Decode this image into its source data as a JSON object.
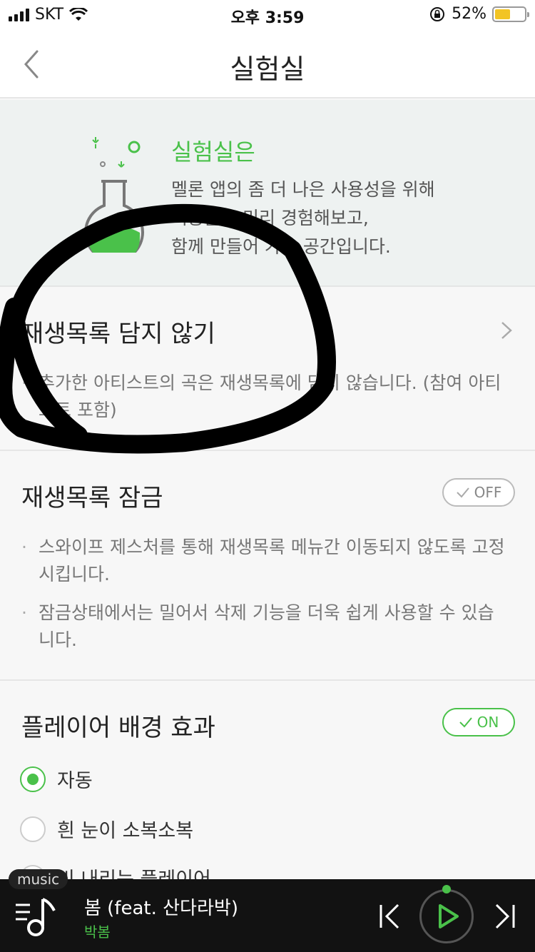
{
  "status_bar": {
    "carrier": "SKT",
    "time": "오후 3:59",
    "battery_percent": "52%",
    "battery_level": 0.52
  },
  "nav": {
    "title": "실험실"
  },
  "intro": {
    "title": "실험실은",
    "line1": "멜론 앱의 좀 더 나은 사용성을 위해",
    "line2": "기능들을 미리 경험해보고,",
    "line3": "함께 만들어 가는 공간입니다."
  },
  "sections": [
    {
      "title": "재생목록 담지 않기",
      "bullets": [
        "추가한 아티스트의 곡은 재생목록에 담지 않습니다. (참여 아티스트 포함)"
      ]
    },
    {
      "title": "재생목록 잠금",
      "toggle": "OFF",
      "bullets": [
        "스와이프 제스처를 통해 재생목록 메뉴간 이동되지 않도록 고정시킵니다.",
        "잠금상태에서는 밀어서 삭제 기능을 더욱 쉽게 사용할 수 있습니다."
      ]
    },
    {
      "title": "플레이어 배경 효과",
      "toggle": "ON",
      "options": [
        "자동",
        "흰 눈이 소복소복",
        "비 내리는 플레이어"
      ],
      "selected_option": "자동"
    }
  ],
  "player": {
    "badge": "music",
    "song": "봄 (feat. 산다라박)",
    "artist": "박봄"
  },
  "colors": {
    "accent": "#4ac14a",
    "player_bg": "#121212",
    "intro_bg": "#eef2f1"
  }
}
